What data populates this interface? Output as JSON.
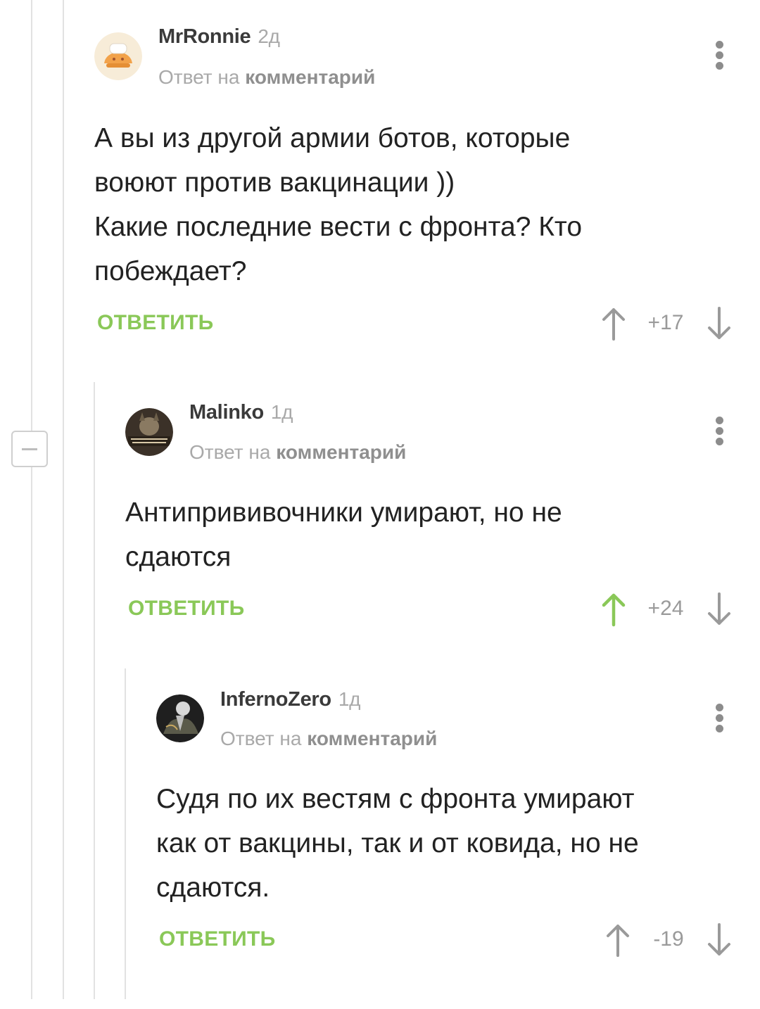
{
  "comments": [
    {
      "author": "MrRonnie",
      "time": "2д",
      "reply_prefix": "Ответ на",
      "reply_link": "комментарий",
      "lines": [
        "А вы из другой армии ботов, которые",
        "воюют против вакцинации ))",
        "Какие последние вести с фронта? Кто",
        "побеждает?"
      ],
      "reply_button": "ОТВЕТИТЬ",
      "rating": "+17",
      "upvoted": false
    },
    {
      "author": "Malinko",
      "time": "1д",
      "reply_prefix": "Ответ на",
      "reply_link": "комментарий",
      "lines": [
        "Антипрививочники умирают, но не",
        "сдаются"
      ],
      "reply_button": "ОТВЕТИТЬ",
      "rating": "+24",
      "upvoted": true
    },
    {
      "author": "InfernoZero",
      "time": "1д",
      "reply_prefix": "Ответ на",
      "reply_link": "комментарий",
      "lines": [
        "Судя по их вестям с фронта умирают",
        "как от вакцины, так и от ковида, но не",
        "сдаются."
      ],
      "reply_button": "ОТВЕТИТЬ",
      "rating": "-19",
      "upvoted": false
    }
  ],
  "colors": {
    "accent_green": "#8ac858",
    "muted_gray": "#a9a9a9",
    "thread_line": "#e2e2e2"
  },
  "icons": [
    "more-vertical-icon",
    "arrow-up-icon",
    "arrow-down-icon",
    "collapse-minus-icon"
  ]
}
